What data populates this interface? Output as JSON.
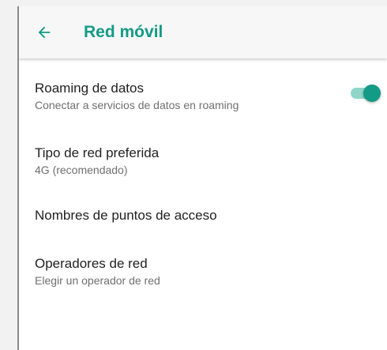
{
  "colors": {
    "accent": "#139b86",
    "switch_track": "#8fd6c9",
    "title_text": "#212121",
    "summary_text": "#6f6f6f",
    "appbar_bg": "#f7f7f7"
  },
  "appbar": {
    "back_icon": "arrow-left-icon",
    "title": "Red móvil"
  },
  "items": [
    {
      "title": "Roaming de datos",
      "summary": "Conectar a servicios de datos en roaming",
      "switch": {
        "on": true
      }
    },
    {
      "title": "Tipo de red preferida",
      "summary": "4G (recomendado)"
    },
    {
      "title": "Nombres de puntos de acceso"
    },
    {
      "title": "Operadores de red",
      "summary": "Elegir un operador de red"
    }
  ]
}
